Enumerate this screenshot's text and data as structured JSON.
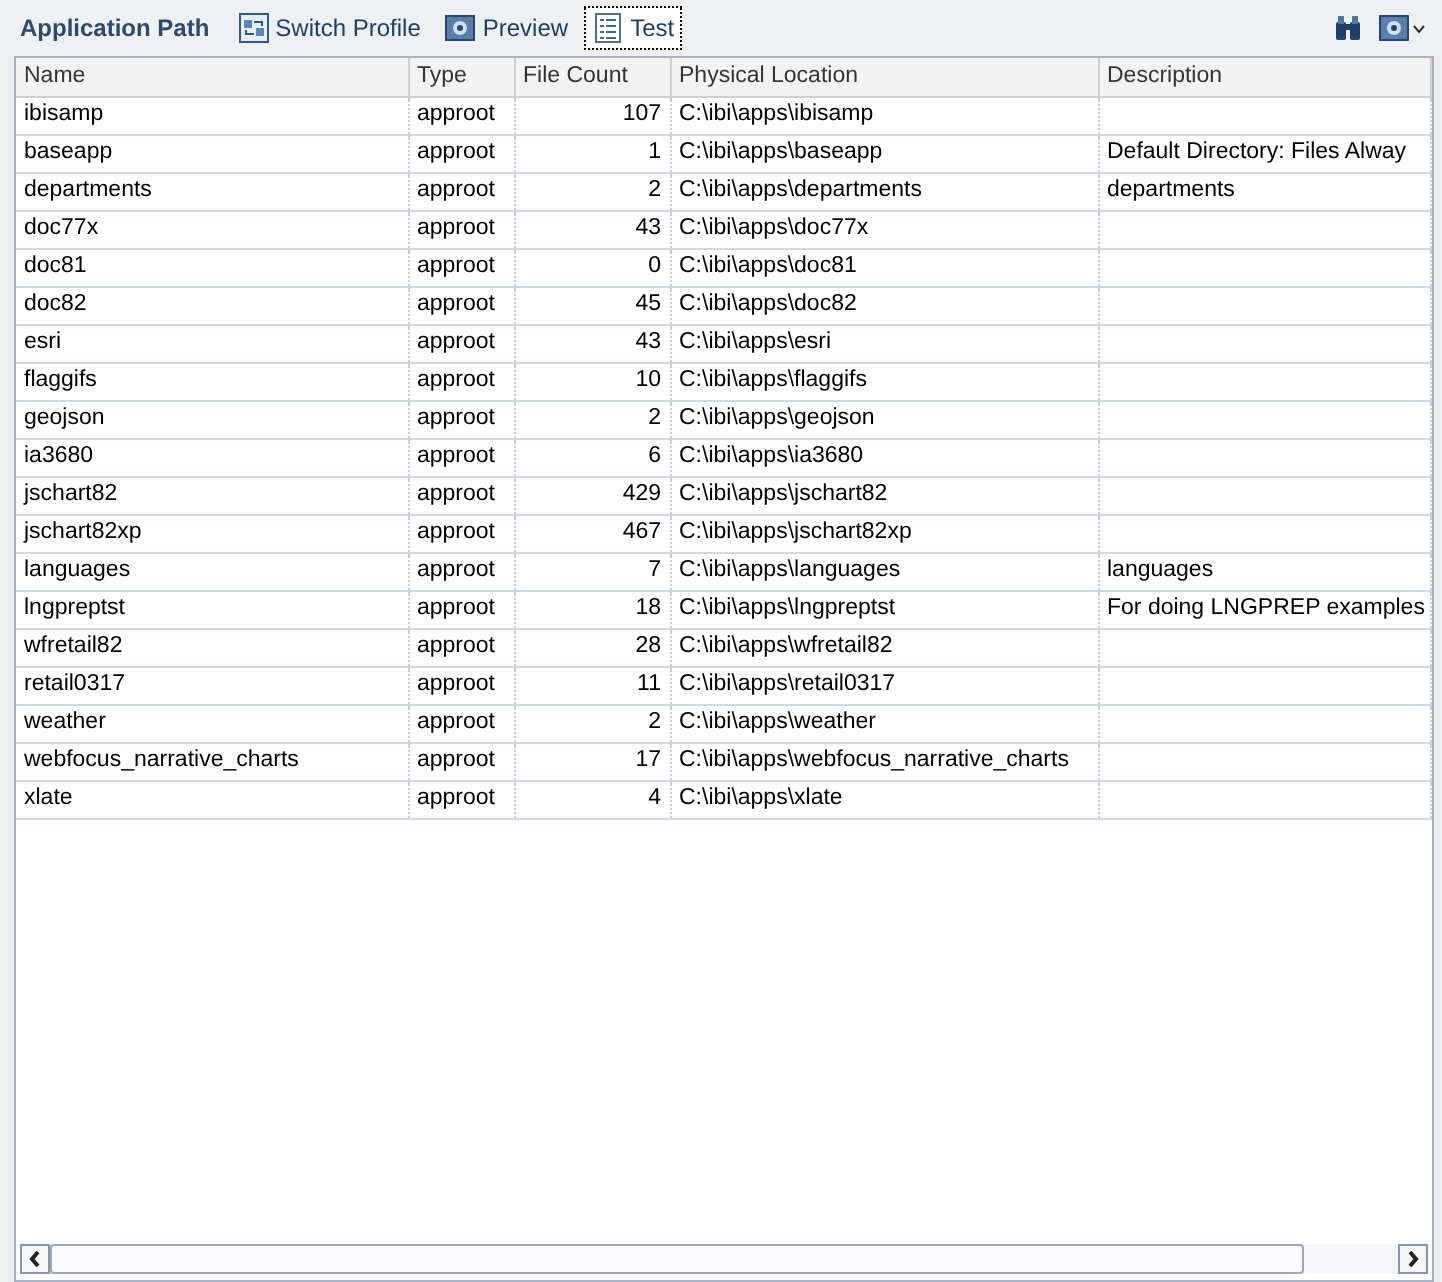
{
  "toolbar": {
    "title": "Application Path",
    "buttons": [
      {
        "label": "Switch Profile",
        "selected": false
      },
      {
        "label": "Preview",
        "selected": false
      },
      {
        "label": "Test",
        "selected": true
      }
    ]
  },
  "table": {
    "columns": [
      "Name",
      "Type",
      "File Count",
      "Physical Location",
      "Description"
    ],
    "rows": [
      [
        "ibisamp",
        "approot",
        "107",
        "C:\\ibi\\apps\\ibisamp",
        ""
      ],
      [
        "baseapp",
        "approot",
        "1",
        "C:\\ibi\\apps\\baseapp",
        "Default Directory: Files Alway"
      ],
      [
        "departments",
        "approot",
        "2",
        "C:\\ibi\\apps\\departments",
        "departments"
      ],
      [
        "doc77x",
        "approot",
        "43",
        "C:\\ibi\\apps\\doc77x",
        ""
      ],
      [
        "doc81",
        "approot",
        "0",
        "C:\\ibi\\apps\\doc81",
        ""
      ],
      [
        "doc82",
        "approot",
        "45",
        "C:\\ibi\\apps\\doc82",
        ""
      ],
      [
        "esri",
        "approot",
        "43",
        "C:\\ibi\\apps\\esri",
        ""
      ],
      [
        "flaggifs",
        "approot",
        "10",
        "C:\\ibi\\apps\\flaggifs",
        ""
      ],
      [
        "geojson",
        "approot",
        "2",
        "C:\\ibi\\apps\\geojson",
        ""
      ],
      [
        "ia3680",
        "approot",
        "6",
        "C:\\ibi\\apps\\ia3680",
        ""
      ],
      [
        "jschart82",
        "approot",
        "429",
        "C:\\ibi\\apps\\jschart82",
        ""
      ],
      [
        "jschart82xp",
        "approot",
        "467",
        "C:\\ibi\\apps\\jschart82xp",
        ""
      ],
      [
        "languages",
        "approot",
        "7",
        "C:\\ibi\\apps\\languages",
        "languages"
      ],
      [
        "lngpreptst",
        "approot",
        "18",
        "C:\\ibi\\apps\\lngpreptst",
        "For doing LNGPREP examples"
      ],
      [
        "wfretail82",
        "approot",
        "28",
        "C:\\ibi\\apps\\wfretail82",
        ""
      ],
      [
        "retail0317",
        "approot",
        "11",
        "C:\\ibi\\apps\\retail0317",
        ""
      ],
      [
        "weather",
        "approot",
        "2",
        "C:\\ibi\\apps\\weather",
        ""
      ],
      [
        "webfocus_narrative_charts",
        "approot",
        "17",
        "C:\\ibi\\apps\\webfocus_narrative_charts",
        ""
      ],
      [
        "xlate",
        "approot",
        "4",
        "C:\\ibi\\apps\\xlate",
        ""
      ]
    ]
  }
}
